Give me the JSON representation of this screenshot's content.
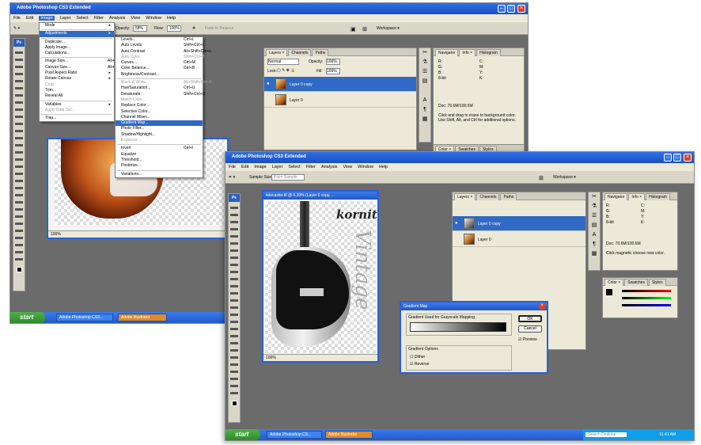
{
  "screen1": {
    "title": "Adobe Photoshop CS3 Extended",
    "menu": [
      "File",
      "Edit",
      "Image",
      "Layer",
      "Select",
      "Filter",
      "Analysis",
      "View",
      "Window",
      "Help"
    ],
    "options": {
      "mode_label": "Opacity:",
      "opacity": "58%",
      "flow_label": "Flow:",
      "flow": "100%",
      "placeholder": "Fade to Balance",
      "workspace": "Workspace ▾"
    },
    "image_menu": [
      {
        "label": "Mode",
        "arrow": "▸"
      },
      {
        "sep": true
      },
      {
        "label": "Adjustments",
        "arrow": "▸",
        "sel": true
      },
      {
        "sep": true
      },
      {
        "label": "Duplicate..."
      },
      {
        "label": "Apply Image..."
      },
      {
        "label": "Calculations..."
      },
      {
        "sep": true
      },
      {
        "label": "Image Size...",
        "sc": "Alt+Ctrl+I"
      },
      {
        "label": "Canvas Size...",
        "sc": "Alt+Ctrl+C"
      },
      {
        "label": "Pixel Aspect Ratio",
        "arrow": "▸"
      },
      {
        "label": "Rotate Canvas",
        "arrow": "▸"
      },
      {
        "label": "Crop",
        "dis": true
      },
      {
        "label": "Trim..."
      },
      {
        "label": "Reveal All"
      },
      {
        "sep": true
      },
      {
        "label": "Variables",
        "arrow": "▸"
      },
      {
        "label": "Apply Data Set...",
        "dis": true
      },
      {
        "sep": true
      },
      {
        "label": "Trap..."
      }
    ],
    "adjust_menu": [
      {
        "label": "Levels...",
        "sc": "Ctrl+L"
      },
      {
        "label": "Auto Levels",
        "sc": "Shift+Ctrl+L"
      },
      {
        "label": "Auto Contrast",
        "sc": "Alt+Shift+Ctrl+L"
      },
      {
        "label": "Auto Color",
        "sc": "Shift+Ctrl+B",
        "dis": true
      },
      {
        "label": "Curves...",
        "sc": "Ctrl+M"
      },
      {
        "label": "Color Balance...",
        "sc": "Ctrl+B"
      },
      {
        "label": "Brightness/Contrast..."
      },
      {
        "sep": true
      },
      {
        "label": "Black & White...",
        "sc": "Alt+Shift+Ctrl+B",
        "dis": true
      },
      {
        "label": "Hue/Saturation...",
        "sc": "Ctrl+U"
      },
      {
        "label": "Desaturate",
        "sc": "Shift+Ctrl+U"
      },
      {
        "label": "Match Color...",
        "dis": true
      },
      {
        "label": "Replace Color..."
      },
      {
        "label": "Selective Color..."
      },
      {
        "label": "Channel Mixer..."
      },
      {
        "label": "Gradient Map...",
        "sel": true
      },
      {
        "label": "Photo Filter..."
      },
      {
        "label": "Shadow/Highlight..."
      },
      {
        "label": "Exposure...",
        "dis": true
      },
      {
        "sep": true
      },
      {
        "label": "Invert",
        "sc": "Ctrl+I"
      },
      {
        "label": "Equalize"
      },
      {
        "label": "Threshold..."
      },
      {
        "label": "Posterize..."
      },
      {
        "sep": true
      },
      {
        "label": "Variations..."
      }
    ],
    "layers": {
      "tabs": [
        "Layers ×",
        "Channels",
        "Paths"
      ],
      "blend": "Normal",
      "opacity_label": "Opacity:",
      "opacity": "100%",
      "lock_label": "Lock:",
      "fill_label": "Fill:",
      "fill": "100%",
      "rows": [
        "Layer 0 copy",
        "Layer 0"
      ]
    },
    "info": {
      "tabs": [
        "Navigator",
        "Info ×",
        "Histogram"
      ],
      "doc": "Doc: 70.6M/100.6M",
      "help": "Click and drag to erase to background color. Use Shift, Alt, and Ctrl for additional options.",
      "color_tabs": [
        "Color ×",
        "Swatches",
        "Styles"
      ]
    },
    "doc_status": "100%",
    "taskbar": {
      "start": "start",
      "btn1": "Adobe Photoshop CS3...",
      "btn2": "Adobe Illustrator"
    }
  },
  "screen2": {
    "title": "Adobe Photoshop CS3 Extended",
    "menu": [
      "File",
      "Edit",
      "Image",
      "Layer",
      "Select",
      "Filter",
      "Analysis",
      "View",
      "Window",
      "Help"
    ],
    "options": {
      "sample_label": "Sample Size:",
      "sample": "Point Sample",
      "workspace": "Workspace ▾"
    },
    "doc_title": "telecaster.tif @ 6.33% (Layer 0 copy, ...",
    "logo": "kornit",
    "script": "Vintage",
    "doc_status": "100%",
    "layers": {
      "tabs": [
        "Layers ×",
        "Channels",
        "Paths"
      ],
      "rows": [
        "Layer 0 copy",
        "Layer 0"
      ]
    },
    "info": {
      "tabs": [
        "Navigator",
        "Info ×",
        "Histogram"
      ],
      "doc": "Doc: 70.6M/100.6M",
      "help": "Click magnetic choose new color.",
      "color_tabs": [
        "Color ×",
        "Swatches",
        "Styles"
      ]
    },
    "dialog": {
      "title": "Gradient Map",
      "group1": "Gradient Used for Grayscale Mapping",
      "ok": "OK",
      "cancel": "Cancel",
      "preview": "Preview",
      "group2": "Gradient Options",
      "dither": "Dither",
      "reverse": "Reverse"
    },
    "taskbar": {
      "start": "start",
      "btn1": "Adobe Photoshop CS...",
      "btn2": "Adobe Illustrator",
      "search": "Search Desktop",
      "clock": "11:41 AM"
    }
  }
}
